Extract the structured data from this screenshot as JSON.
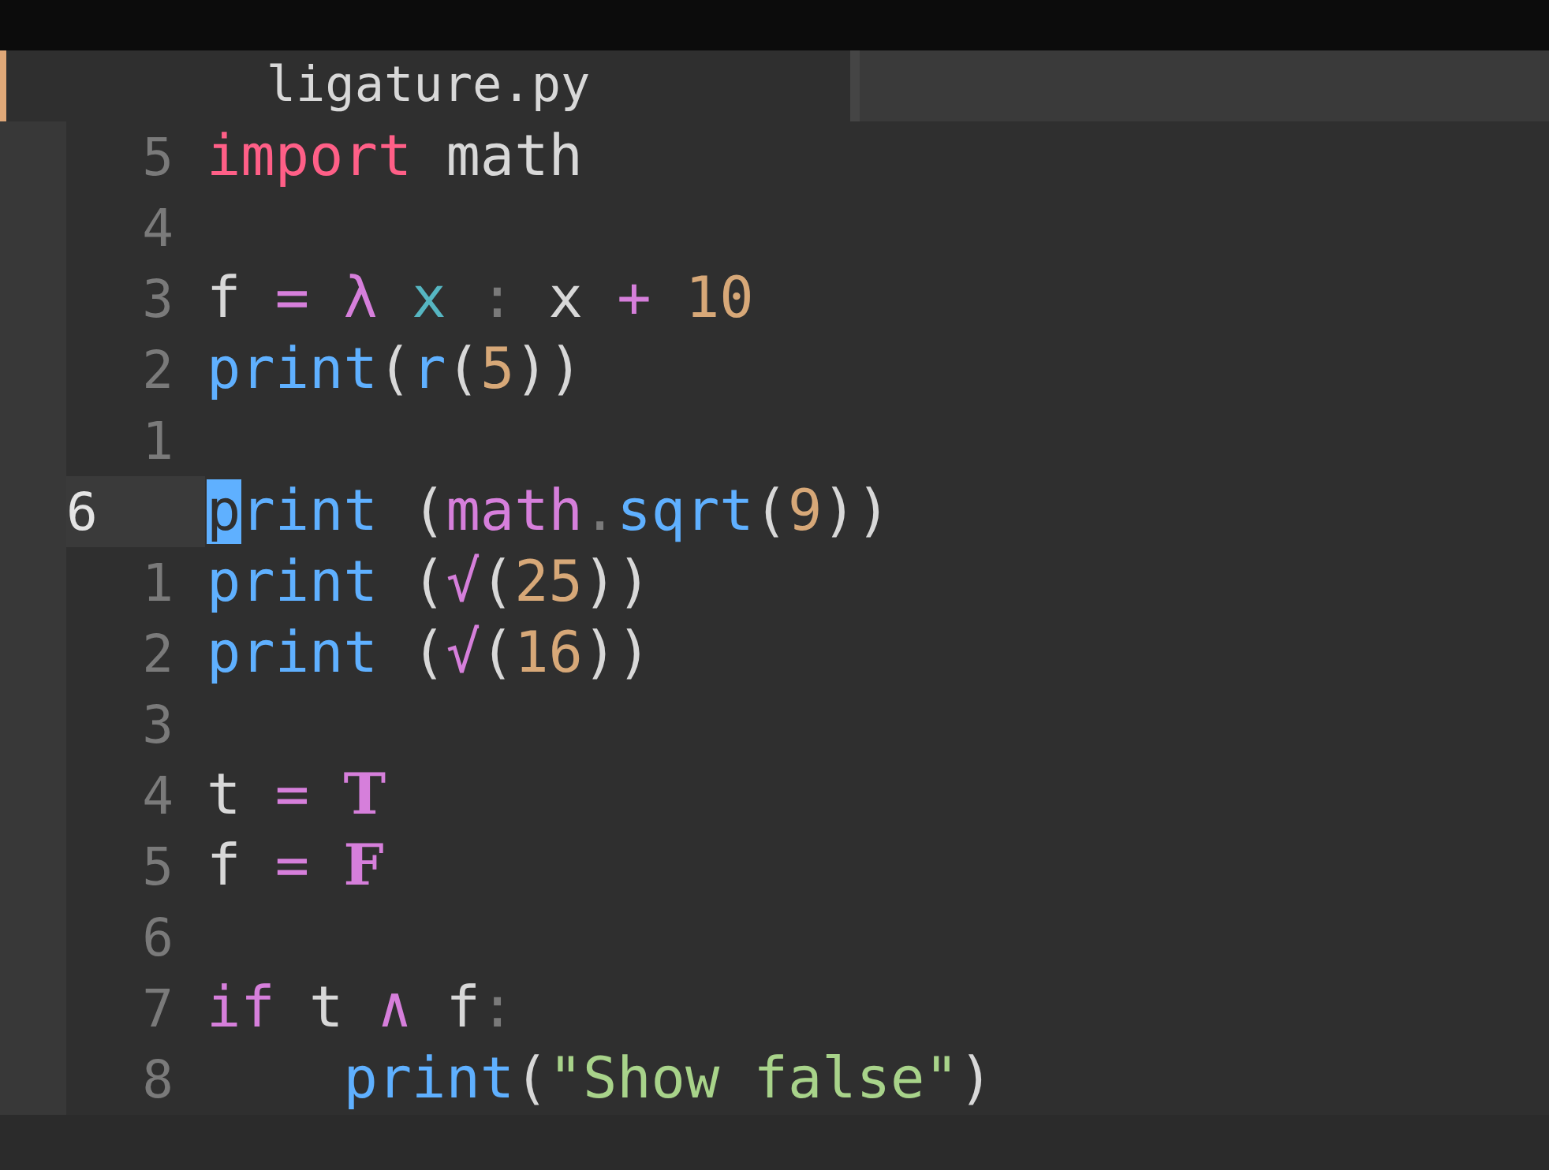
{
  "tab": {
    "title": "ligature.py",
    "selected": true
  },
  "lines": [
    {
      "number": "5",
      "current": false,
      "tokens": [
        {
          "text": "import",
          "kind": "keyword"
        },
        {
          "text": " math",
          "kind": "plain"
        }
      ]
    },
    {
      "number": "4",
      "current": false
    },
    {
      "number": "3",
      "current": false,
      "tokens": [
        {
          "text": "f ",
          "kind": "plain"
        },
        {
          "text": "= λ ",
          "kind": "op"
        },
        {
          "text": "x ",
          "kind": "param"
        },
        {
          "text": ": ",
          "kind": "dim"
        },
        {
          "text": "x ",
          "kind": "plain"
        },
        {
          "text": "+ ",
          "kind": "op"
        },
        {
          "text": "10",
          "kind": "num"
        }
      ]
    },
    {
      "number": "2",
      "current": false,
      "tokens": [
        {
          "text": "print",
          "kind": "fn"
        },
        {
          "text": "(",
          "kind": "plain"
        },
        {
          "text": "r",
          "kind": "fn"
        },
        {
          "text": "(",
          "kind": "plain"
        },
        {
          "text": "5",
          "kind": "num"
        },
        {
          "text": "))",
          "kind": "plain"
        }
      ]
    },
    {
      "number": "1",
      "current": false
    },
    {
      "number": "6",
      "current": true,
      "tokens": [
        {
          "text": "p",
          "kind": "cursor"
        },
        {
          "text": "rint",
          "kind": "fn"
        },
        {
          "text": " (",
          "kind": "plain"
        },
        {
          "text": "math",
          "kind": "op"
        },
        {
          "text": ".",
          "kind": "dim"
        },
        {
          "text": "sqrt",
          "kind": "fn"
        },
        {
          "text": "(",
          "kind": "plain"
        },
        {
          "text": "9",
          "kind": "num"
        },
        {
          "text": "))",
          "kind": "plain"
        }
      ]
    },
    {
      "number": "1",
      "current": false,
      "tokens": [
        {
          "text": "print",
          "kind": "fn"
        },
        {
          "text": " (",
          "kind": "plain"
        },
        {
          "text": "√",
          "kind": "op"
        },
        {
          "text": "(",
          "kind": "plain"
        },
        {
          "text": "25",
          "kind": "num"
        },
        {
          "text": "))",
          "kind": "plain"
        }
      ]
    },
    {
      "number": "2",
      "current": false,
      "tokens": [
        {
          "text": "print",
          "kind": "fn"
        },
        {
          "text": " (",
          "kind": "plain"
        },
        {
          "text": "√",
          "kind": "op"
        },
        {
          "text": "(",
          "kind": "plain"
        },
        {
          "text": "16",
          "kind": "num"
        },
        {
          "text": "))",
          "kind": "plain"
        }
      ]
    },
    {
      "number": "3",
      "current": false
    },
    {
      "number": "4",
      "current": false,
      "tokens": [
        {
          "text": "t ",
          "kind": "plain"
        },
        {
          "text": "= ",
          "kind": "op"
        },
        {
          "text": "T",
          "kind": "const"
        }
      ]
    },
    {
      "number": "5",
      "current": false,
      "tokens": [
        {
          "text": "f ",
          "kind": "plain"
        },
        {
          "text": "= ",
          "kind": "op"
        },
        {
          "text": "F",
          "kind": "const"
        }
      ]
    },
    {
      "number": "6",
      "current": false
    },
    {
      "number": "7",
      "current": false,
      "tokens": [
        {
          "text": "if",
          "kind": "op"
        },
        {
          "text": " t ",
          "kind": "plain"
        },
        {
          "text": "∧ ",
          "kind": "op"
        },
        {
          "text": "f",
          "kind": "plain"
        },
        {
          "text": ":",
          "kind": "dim"
        }
      ]
    },
    {
      "number": "8",
      "current": false,
      "tokens": [
        {
          "text": "    print",
          "kind": "fn"
        },
        {
          "text": "(",
          "kind": "plain"
        },
        {
          "text": "\"Show false\"",
          "kind": "string"
        },
        {
          "text": ")",
          "kind": "plain"
        }
      ]
    }
  ]
}
